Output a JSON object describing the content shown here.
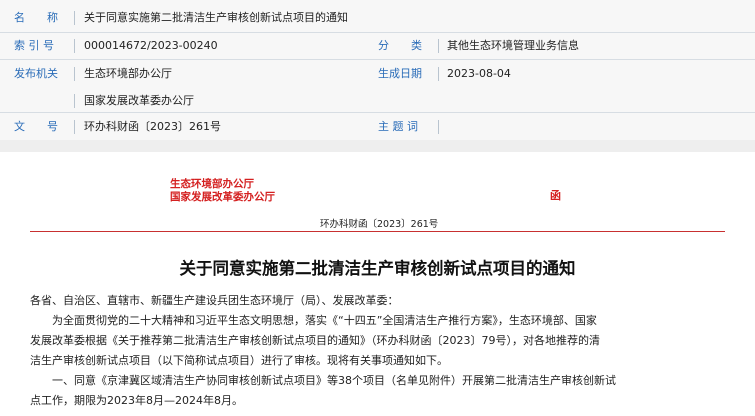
{
  "meta": {
    "name": {
      "label": "名　　称",
      "value": "关于同意实施第二批清洁生产审核创新试点项目的通知"
    },
    "index": {
      "label": "索 引 号",
      "value": "000014672/2023-00240"
    },
    "category": {
      "label": "分　　类",
      "value": "其他生态环境管理业务信息"
    },
    "issuer": {
      "label": "发布机关",
      "value1": "生态环境部办公厅",
      "value2": "国家发展改革委办公厅"
    },
    "date": {
      "label": "生成日期",
      "value": "2023-08-04"
    },
    "docno": {
      "label": "文　　号",
      "value": "环办科财函〔2023〕261号"
    },
    "subject": {
      "label": "主 题 词",
      "value": ""
    }
  },
  "doc": {
    "issuer_line1": "生态环境部办公厅",
    "issuer_line2": "国家发展改革委办公厅",
    "han": "函",
    "docno": "环办科财函〔2023〕261号",
    "title": "关于同意实施第二批清洁生产审核创新试点项目的通知",
    "salutation": "各省、自治区、直辖市、新疆生产建设兵团生态环境厅（局）、发展改革委：",
    "para1_line1": "　　为全面贯彻党的二十大精神和习近平生态文明思想，落实《“十四五”全国清洁生产推行方案》，生态环境部、国家",
    "para1_line2": "发展改革委根据《关于推荐第二批清洁生产审核创新试点项目的通知》（环办科财函〔2023〕79号），对各地推荐的清",
    "para1_line3": "洁生产审核创新试点项目（以下简称试点项目）进行了审核。现将有关事项通知如下。",
    "para2_line1": "　　一、同意《京津冀区域清洁生产协同审核创新试点项目》等38个项目（名单见附件）开展第二批清洁生产审核创新试",
    "para2_line2": "点工作，期限为2023年8月—2024年8月。"
  }
}
